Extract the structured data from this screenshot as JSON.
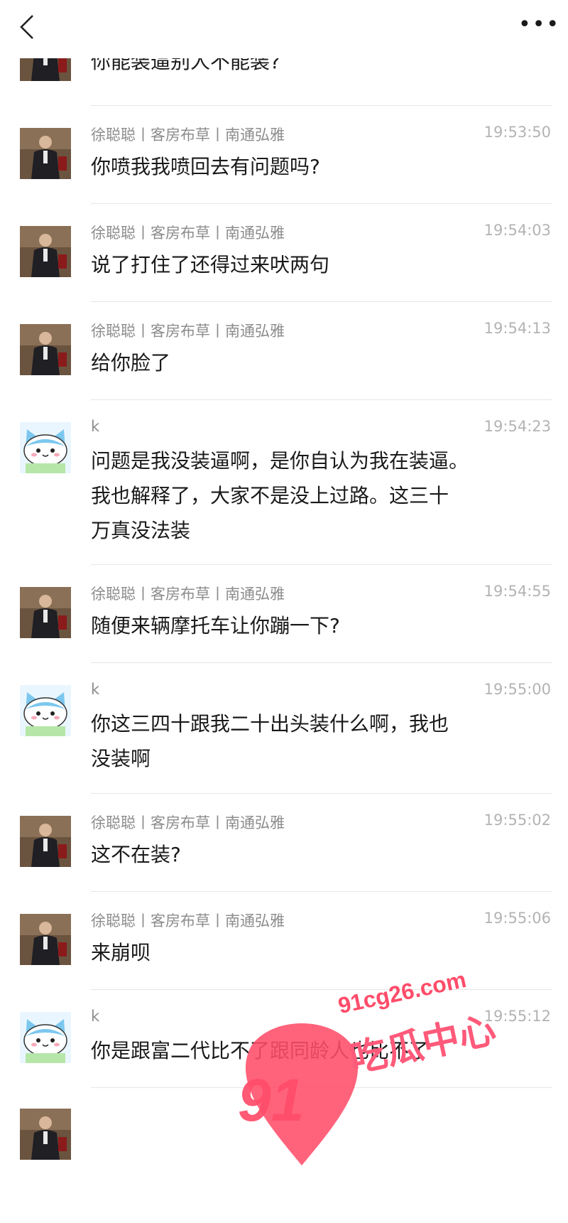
{
  "topbar": {
    "back_icon": "chevron-left-icon",
    "more_label": "•••"
  },
  "colors": {
    "sender_a": "#5b4636",
    "sender_b": "#8fd3f0",
    "watermark": "#ff4d6a"
  },
  "messages": [
    {
      "sender": "",
      "avatar": "photo",
      "time": "",
      "lines": [
        "你能装逼别人不能装?"
      ]
    },
    {
      "sender": "徐聪聪丨客房布草丨南通弘雅",
      "avatar": "photo",
      "time": "19:53:50",
      "lines": [
        "你喷我我喷回去有问题吗?"
      ]
    },
    {
      "sender": "徐聪聪丨客房布草丨南通弘雅",
      "avatar": "photo",
      "time": "19:54:03",
      "lines": [
        "说了打住了还得过来吠两句"
      ]
    },
    {
      "sender": "徐聪聪丨客房布草丨南通弘雅",
      "avatar": "photo",
      "time": "19:54:13",
      "lines": [
        "给你脸了"
      ]
    },
    {
      "sender": "k",
      "avatar": "cat",
      "time": "19:54:23",
      "lines": [
        "问题是我没装逼啊，是你自认为我在装逼。",
        "我也解释了，大家不是没上过路。这三十",
        "万真没法装"
      ]
    },
    {
      "sender": "徐聪聪丨客房布草丨南通弘雅",
      "avatar": "photo",
      "time": "19:54:55",
      "lines": [
        "随便来辆摩托车让你蹦一下?"
      ]
    },
    {
      "sender": "k",
      "avatar": "cat",
      "time": "19:55:00",
      "lines": [
        "你这三四十跟我二十出头装什么啊，我也",
        "没装啊"
      ]
    },
    {
      "sender": "徐聪聪丨客房布草丨南通弘雅",
      "avatar": "photo",
      "time": "19:55:02",
      "lines": [
        "这不在装?"
      ]
    },
    {
      "sender": "徐聪聪丨客房布草丨南通弘雅",
      "avatar": "photo",
      "time": "19:55:06",
      "lines": [
        "来崩呗"
      ]
    },
    {
      "sender": "k",
      "avatar": "cat",
      "time": "19:55:12",
      "lines": [
        "你是跟富二代比不了跟同龄人也比不了"
      ]
    }
  ],
  "watermark": {
    "domain": "91cg26.com",
    "name": "吃瓜中心",
    "number": "91"
  }
}
